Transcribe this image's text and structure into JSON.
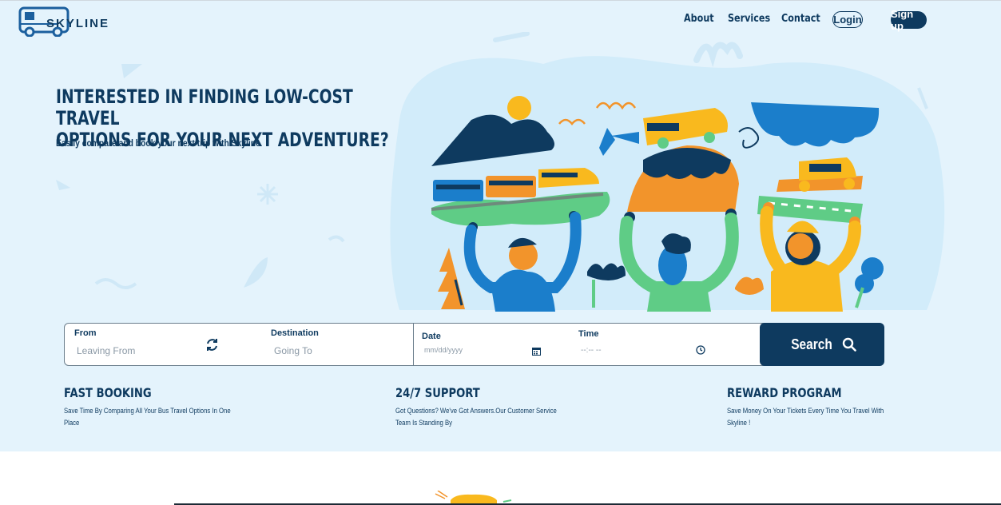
{
  "brand": {
    "name": "SKYLINE"
  },
  "nav": {
    "about": "About",
    "services": "Services",
    "contact": "Contact",
    "login": "Login",
    "signup": "Sign up"
  },
  "hero": {
    "title_line1": "INTERESTED IN FINDING LOW-COST TRAVEL",
    "title_line2": "OPTIONS FOR YOUR NEXT ADVENTURE?",
    "subtitle": "Easily compare and book your next trip with Skyline"
  },
  "search": {
    "from_label": "From",
    "from_placeholder": "Leaving From",
    "destination_label": "Destination",
    "destination_placeholder": "Going To",
    "date_label": "Date",
    "date_placeholder": "mm/dd/yyyy",
    "time_label": "Time",
    "time_placeholder": "--:-- --",
    "button_label": "Search"
  },
  "features": [
    {
      "title": "FAST BOOKING",
      "description": "Save Time By Comparing All Your Bus Travel Options In One Place"
    },
    {
      "title": "24/7 SUPPORT",
      "description": "Got Questions? We've Got Answers.Our Customer Service Team Is Standing By"
    },
    {
      "title": "REWARD PROGRAM",
      "description": "Save Money On Your Tickets Every Time You Travel With Skyline !"
    }
  ],
  "icons": {
    "logo": "bus-icon",
    "swap": "swap-arrows-icon",
    "calendar": "calendar-icon",
    "clock": "clock-icon",
    "search": "search-icon"
  },
  "colors": {
    "primary": "#0e3a5f",
    "hero_bg": "#e4f3fc",
    "accent_orange": "#f2942b",
    "accent_yellow": "#f9b91e",
    "accent_blue": "#1b7ecb",
    "accent_green": "#5fcc86"
  }
}
